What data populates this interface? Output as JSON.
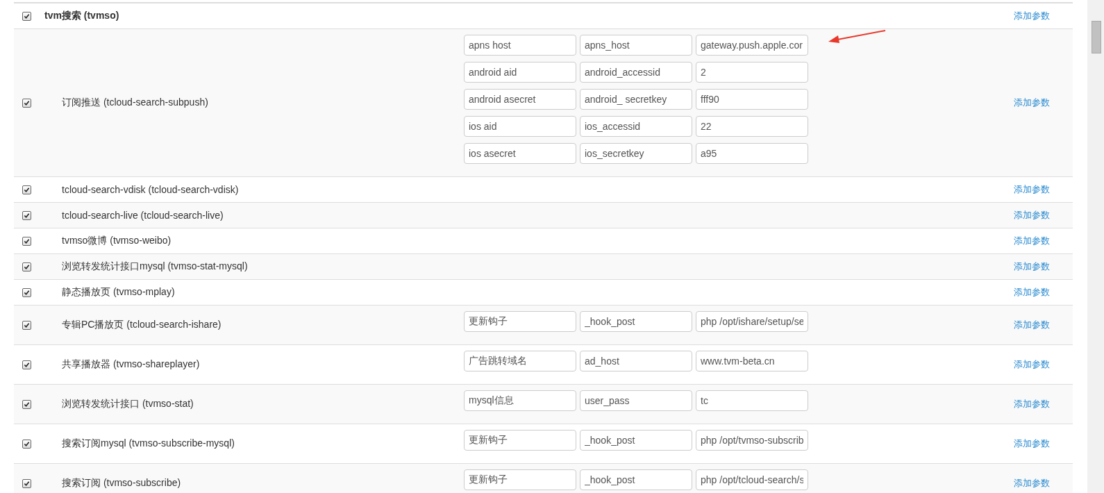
{
  "modules": [
    {
      "name": "tvm搜索 (tvmso)",
      "checked": true,
      "action": "添加参数",
      "children": [
        {
          "name": "订阅推送 (tcloud-search-subpush)",
          "checked": true,
          "action": "添加参数",
          "params": [
            {
              "label": "apns host",
              "key": "apns_host",
              "value": "gateway.push.apple.cor"
            },
            {
              "label": "android aid",
              "key": "android_accessid",
              "value": "2"
            },
            {
              "label": "android asecret",
              "key": "android_ secretkey",
              "value": "fff90"
            },
            {
              "label": "ios aid",
              "key": "ios_accessid",
              "value": "22"
            },
            {
              "label": "ios asecret",
              "key": "ios_secretkey",
              "value": "a95"
            }
          ]
        },
        {
          "name": "tcloud-search-vdisk (tcloud-search-vdisk)",
          "checked": true,
          "action": "添加参数"
        },
        {
          "name": "tcloud-search-live (tcloud-search-live)",
          "checked": true,
          "action": "添加参数"
        },
        {
          "name": "tvmso微博 (tvmso-weibo)",
          "checked": true,
          "action": "添加参数"
        },
        {
          "name": "浏览转发统计接口mysql (tvmso-stat-mysql)",
          "checked": true,
          "action": "添加参数"
        },
        {
          "name": "静态播放页 (tvmso-mplay)",
          "checked": true,
          "action": "添加参数"
        },
        {
          "name": "专辑PC播放页 (tcloud-search-ishare)",
          "checked": true,
          "action": "添加参数",
          "params": [
            {
              "label": "更新钩子",
              "key": "_hook_post",
              "value": "php /opt/ishare/setup/se"
            }
          ]
        },
        {
          "name": "共享播放器 (tvmso-shareplayer)",
          "checked": true,
          "action": "添加参数",
          "params": [
            {
              "label": "广告跳转域名",
              "key": "ad_host",
              "value": "www.tvm-beta.cn"
            }
          ]
        },
        {
          "name": "浏览转发统计接口 (tvmso-stat)",
          "checked": true,
          "action": "添加参数",
          "params": [
            {
              "label": "mysql信息",
              "key": "user_pass",
              "value": "tc"
            }
          ]
        },
        {
          "name": "搜索订阅mysql (tvmso-subscribe-mysql)",
          "checked": true,
          "action": "添加参数",
          "params": [
            {
              "label": "更新钩子",
              "key": "_hook_post",
              "value": "php /opt/tvmso-subscrib"
            }
          ]
        },
        {
          "name": "搜索订阅 (tvmso-subscribe)",
          "checked": true,
          "action": "添加参数",
          "params": [
            {
              "label": "更新钩子",
              "key": "_hook_post",
              "value": "php /opt/tcloud-search/s"
            }
          ]
        }
      ]
    }
  ]
}
